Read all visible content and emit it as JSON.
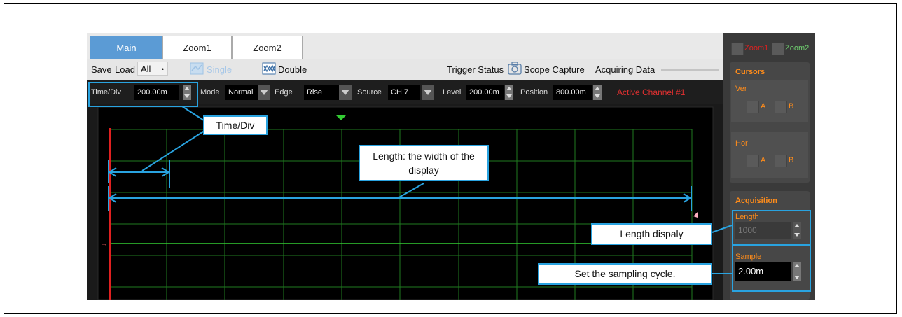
{
  "tabs": [
    {
      "label": "Main"
    },
    {
      "label": "Zoom1"
    },
    {
      "label": "Zoom2"
    }
  ],
  "toolbar": {
    "save_label": "Save",
    "load_label": "Load",
    "load_select_value": "All",
    "single_label": "Single",
    "double_label": "Double",
    "trigger_status_label": "Trigger Status",
    "scope_capture_label": "Scope Capture",
    "acquiring_data_label": "Acquiring Data"
  },
  "controls": {
    "time_div_label": "Time/Div",
    "time_div_value": "200.00m",
    "mode_label": "Mode",
    "mode_value": "Normal",
    "edge_label": "Edge",
    "edge_value": "Rise",
    "source_label": "Source",
    "source_value": "CH 7",
    "level_label": "Level",
    "level_value": "200.00m",
    "position_label": "Position",
    "position_value": "800.00m",
    "active_channel": "Active Channel #1"
  },
  "right_panel": {
    "zoom1_label": "Zoom1",
    "zoom2_label": "Zoom2",
    "cursors_title": "Cursors",
    "ver_label": "Ver",
    "hor_label": "Hor",
    "a_label": "A",
    "b_label": "B",
    "acquisition_title": "Acquisition",
    "length_label": "Length",
    "length_value": "1000",
    "sample_label": "Sample",
    "sample_value": "2.00m"
  },
  "callouts": {
    "time_div": "Time/Div",
    "length": "Length: the width of the display",
    "length_display": "Length dispaly",
    "sample": "Set the sampling cycle."
  },
  "colors": {
    "accent_blue": "#5b9bd5",
    "callout_blue": "#29a3e0",
    "grid_green": "#1f8a1f",
    "trace_green": "#33cc33",
    "cursor_red": "#e02020",
    "orange": "#ff8c1a"
  }
}
